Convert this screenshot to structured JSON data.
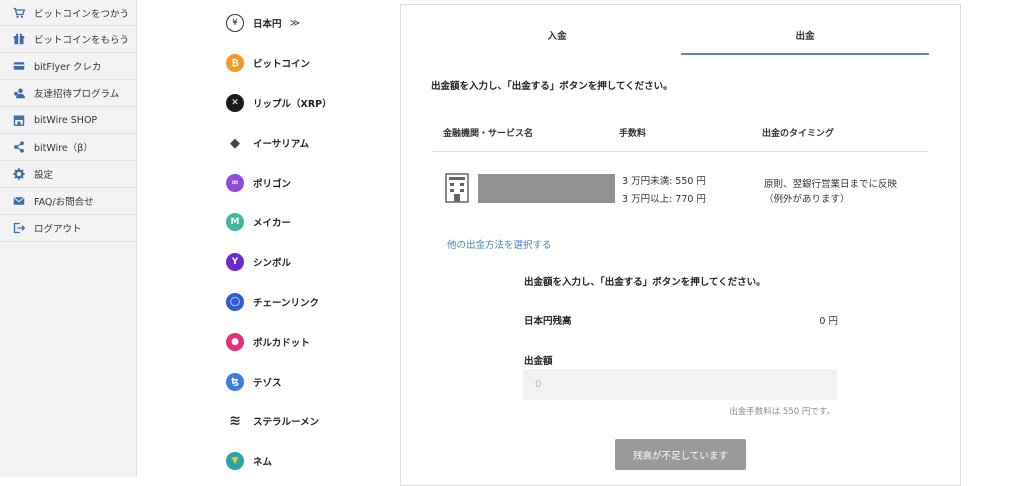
{
  "sidebar": {
    "items": [
      {
        "label": "ビットコインをつかう",
        "icon": "cart-icon"
      },
      {
        "label": "ビットコインをもらう",
        "icon": "gift-icon"
      },
      {
        "label": "bitFlyer クレカ",
        "icon": "credit-card-icon"
      },
      {
        "label": "友達招待プログラム",
        "icon": "invite-friends-icon"
      },
      {
        "label": "bitWire SHOP",
        "icon": "shop-icon"
      },
      {
        "label": "bitWire（β）",
        "icon": "share-icon"
      },
      {
        "label": "設定",
        "icon": "gear-icon"
      },
      {
        "label": "FAQ/お問合せ",
        "icon": "mail-icon"
      },
      {
        "label": "ログアウト",
        "icon": "logout-icon"
      }
    ]
  },
  "currencies": [
    {
      "label": "日本円",
      "icon": "yen-icon",
      "glyph": "¥",
      "arrow": "≫"
    },
    {
      "label": "ビットコイン",
      "icon": "bitcoin-icon",
      "glyph": "₿",
      "color": "#f09a2c"
    },
    {
      "label": "リップル（XRP）",
      "icon": "xrp-icon",
      "glyph": "✕",
      "color": "#1a1a1a"
    },
    {
      "label": "イーサリアム",
      "icon": "ethereum-icon",
      "glyph": "◆",
      "color": "#444444"
    },
    {
      "label": "ポリゴン",
      "icon": "polygon-icon",
      "glyph": "∞",
      "color": "#8d4be0"
    },
    {
      "label": "メイカー",
      "icon": "maker-icon",
      "glyph": "M",
      "color": "#3fb6a1"
    },
    {
      "label": "シンボル",
      "icon": "symbol-icon",
      "glyph": "Y",
      "color": "#6c2bd0"
    },
    {
      "label": "チェーンリンク",
      "icon": "chainlink-icon",
      "glyph": "◯",
      "color": "#2f5bd3"
    },
    {
      "label": "ポルカドット",
      "icon": "polkadot-icon",
      "glyph": "●",
      "color": "#e0307a"
    },
    {
      "label": "テゾス",
      "icon": "tezos-icon",
      "glyph": "ꜩ",
      "color": "#3b7ee0"
    },
    {
      "label": "ステラルーメン",
      "icon": "stellar-icon",
      "glyph": "≋",
      "color": "#333333"
    },
    {
      "label": "ネム",
      "icon": "nem-icon",
      "glyph": "▼",
      "color": "#2aa6a0"
    }
  ],
  "tabs": [
    {
      "label": "入金",
      "active": false
    },
    {
      "label": "出金",
      "active": true
    }
  ],
  "instructions": "出金額を入力し、「出金する」ボタンを押してください。",
  "table": {
    "headers": [
      "金融機関・サービス名",
      "手数料",
      "出金のタイミング"
    ],
    "fee_lines": [
      "3 万円未満: 550 円",
      "3 万円以上: 770 円"
    ],
    "timing_lines": [
      "原則、翌銀行営業日までに反映",
      "（例外があります）"
    ]
  },
  "other_method_link": "他の出金方法を選択する",
  "form": {
    "instructions": "出金額を入力し、「出金する」ボタンを押してください。",
    "balance_label": "日本円残高",
    "balance_value": "0 円",
    "amount_label": "出金額",
    "amount_placeholder": "0",
    "fee_note": "出金手数料は 550 円です。",
    "submit_label": "残高が不足しています"
  },
  "colors": {
    "accent": "#5f88b0",
    "link": "#4a82b6",
    "sidebar_icon": "#3d6aa8",
    "disabled_button": "#999999"
  }
}
